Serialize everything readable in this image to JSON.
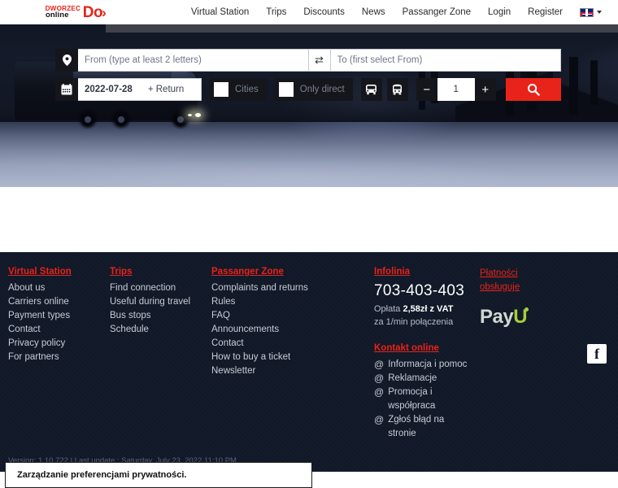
{
  "header": {
    "logo": {
      "top": "DWORZEC",
      "bottom": "online",
      "mark": "Do",
      "chevron": "›"
    },
    "nav": [
      {
        "label": "Virtual Station"
      },
      {
        "label": "Trips"
      },
      {
        "label": "Discounts"
      },
      {
        "label": "News"
      },
      {
        "label": "Passanger Zone"
      },
      {
        "label": "Login"
      },
      {
        "label": "Register"
      }
    ],
    "language": {
      "flag": "uk-flag-icon",
      "caret": "chevron-down-icon"
    }
  },
  "search": {
    "from_placeholder": "From (type at least 2 letters)",
    "from_value": "",
    "to_placeholder": "To (first select From)",
    "to_value": "",
    "swap_icon": "⇄",
    "pin_icon": "location-pin-icon",
    "calendar_icon": "calendar-icon",
    "date_value": "2022-07-28",
    "return_label": "+ Return",
    "cities_label": "Cities",
    "only_direct_label": "Only direct",
    "bus_icon": "bus-icon",
    "train_icon": "train-icon",
    "minus_label": "−",
    "plus_label": "+",
    "passengers_value": "1",
    "search_icon": "search-icon",
    "accent_color": "#e8231a"
  },
  "footer": {
    "columns": [
      {
        "title": "Virtual Station",
        "links": [
          "About us",
          "Carriers online",
          "Payment types",
          "Contact",
          "Privacy policy",
          "For partners"
        ]
      },
      {
        "title": "Trips",
        "links": [
          "Find connection",
          "Useful during travel",
          "Bus stops",
          "Schedule"
        ]
      },
      {
        "title": "Passanger Zone",
        "links": [
          "Complaints and returns",
          "Rules",
          "FAQ",
          "Announcements",
          "Contact",
          "How to buy a ticket",
          "Newsletter"
        ]
      }
    ],
    "infoline": {
      "title": "Infolinia",
      "phone": "703-403-403",
      "fee_line1_pre": "Opłata ",
      "fee_line1_bold": "2,58zł z VAT",
      "fee_line2": "za  1/min połączenia"
    },
    "contact_online": {
      "title": "Kontakt online",
      "at_symbol": "@",
      "items": [
        "Informacja i pomoc",
        "Reklamacje",
        "Promocja i współpraca",
        "Zgłoś błąd na stronie"
      ]
    },
    "payments": {
      "title_line1": "Płatności",
      "title_line2": "obsługuje",
      "logo_pay": "Pay",
      "logo_u": "U"
    },
    "social": {
      "facebook": "f"
    },
    "version": "Version: 1.10.722 | Last update : Saturday, July 23, 2022 11:10 PM"
  },
  "cookie_banner": {
    "text": "Zarządzanie preferencjami prywatności."
  }
}
